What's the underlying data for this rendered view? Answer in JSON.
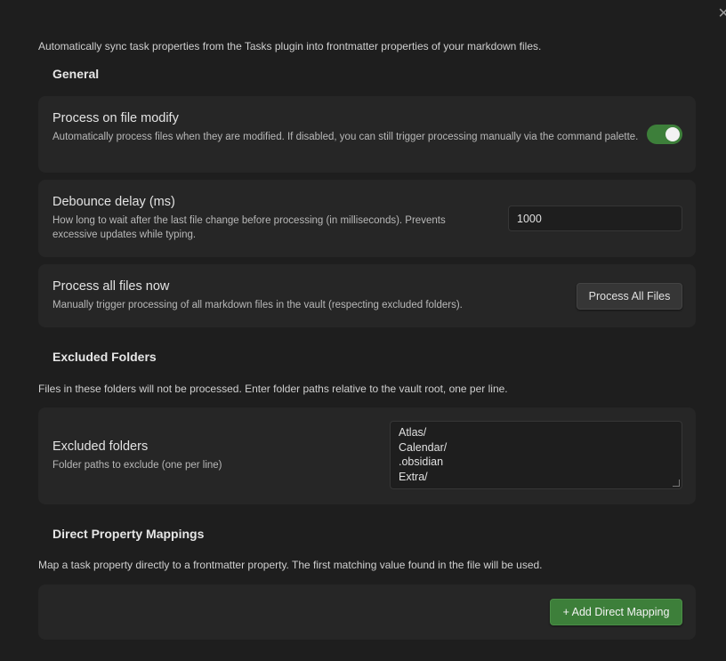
{
  "close_icon": "✕",
  "intro": "Automatically sync task properties from the Tasks plugin into frontmatter properties of your markdown files.",
  "general": {
    "heading": "General",
    "process_on_modify": {
      "name": "Process on file modify",
      "description": "Automatically process files when they are modified. If disabled, you can still trigger processing manually via the command palette.",
      "enabled": true
    },
    "debounce": {
      "name": "Debounce delay (ms)",
      "description": "How long to wait after the last file change before processing (in milliseconds). Prevents excessive updates while typing.",
      "value": "1000"
    },
    "process_all": {
      "name": "Process all files now",
      "description": "Manually trigger processing of all markdown files in the vault (respecting excluded folders).",
      "button_label": "Process All Files"
    }
  },
  "excluded": {
    "heading": "Excluded Folders",
    "description": "Files in these folders will not be processed. Enter folder paths relative to the vault root, one per line.",
    "setting": {
      "name": "Excluded folders",
      "description": "Folder paths to exclude (one per line)",
      "lines": [
        "Atlas/",
        "Calendar/",
        ".obsidian",
        "Extra/"
      ]
    }
  },
  "mappings": {
    "heading": "Direct Property Mappings",
    "description": "Map a task property directly to a frontmatter property. The first matching value found in the file will be used.",
    "add_button_label": "+ Add Direct Mapping"
  },
  "colors": {
    "background": "#1e1e1e",
    "card": "#262626",
    "accent": "#3d7f3a"
  }
}
